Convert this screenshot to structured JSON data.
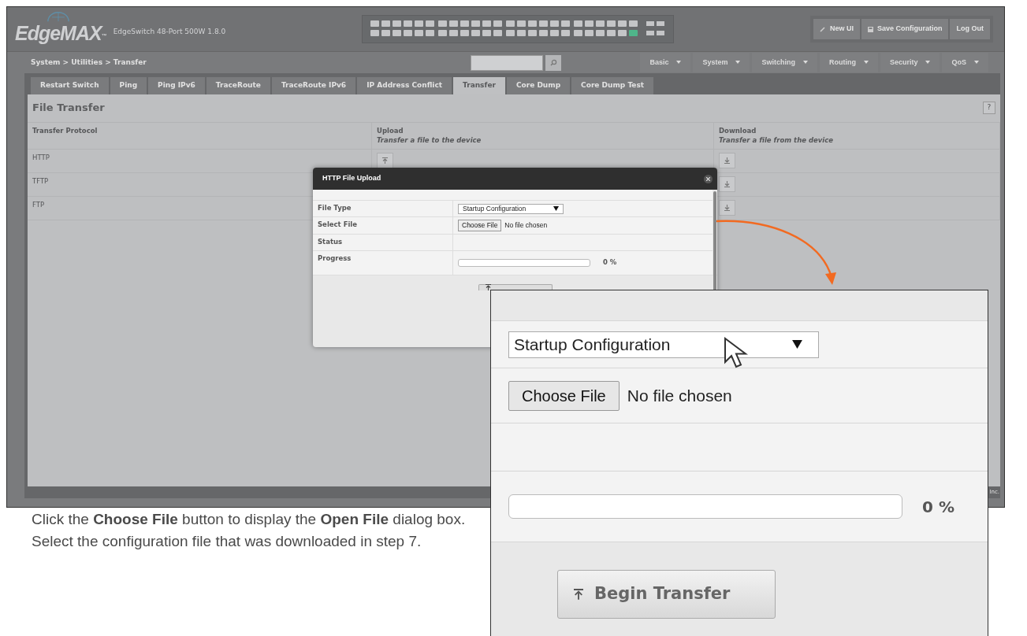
{
  "header": {
    "logo": "EdgeMAX",
    "logo_mark": "™",
    "device": "EdgeSwitch 48-Port 500W 1.8.0",
    "buttons": [
      {
        "kind": "link",
        "label": "New UI"
      },
      {
        "kind": "save",
        "label": "Save Configuration"
      },
      {
        "kind": "plain",
        "label": "Log Out"
      }
    ]
  },
  "breadcrumb": "System > Utilities > Transfer",
  "menus": [
    "Basic",
    "System",
    "Switching",
    "Routing",
    "Security",
    "QoS"
  ],
  "tabs": [
    {
      "label": "Restart Switch",
      "selected": false
    },
    {
      "label": "Ping",
      "selected": false
    },
    {
      "label": "Ping IPv6",
      "selected": false
    },
    {
      "label": "TraceRoute",
      "selected": false
    },
    {
      "label": "TraceRoute IPv6",
      "selected": false
    },
    {
      "label": "IP Address Conflict",
      "selected": false
    },
    {
      "label": "Transfer",
      "selected": true
    },
    {
      "label": "Core Dump",
      "selected": false
    },
    {
      "label": "Core Dump Test",
      "selected": false
    }
  ],
  "panel": {
    "title": "File Transfer",
    "help": "?",
    "columns": [
      {
        "title": "Transfer Protocol"
      },
      {
        "title": "Upload",
        "subtitle": "Transfer a file to the device"
      },
      {
        "title": "Download",
        "subtitle": "Transfer a file from the device"
      }
    ],
    "rows": [
      "HTTP",
      "TFTP",
      "FTP"
    ]
  },
  "footer": "Inc.",
  "dialog": {
    "title": "HTTP File Upload",
    "fields": [
      {
        "kind": "select",
        "label": "File Type",
        "value": "Startup Configuration"
      },
      {
        "kind": "file",
        "label": "Select File",
        "button": "Choose File",
        "value": "No file chosen"
      },
      {
        "kind": "empty",
        "label": "Status"
      },
      {
        "kind": "progress",
        "label": "Progress",
        "level": 0,
        "reading": "0 %"
      }
    ]
  },
  "callout": {
    "fields": [
      {
        "kind": "select",
        "value": "Startup Configuration"
      },
      {
        "kind": "file",
        "button": "Choose File",
        "value": "No file chosen"
      },
      {
        "kind": "empty"
      },
      {
        "kind": "progress",
        "level": 0,
        "reading": "0 %"
      }
    ],
    "button": "Begin Transfer"
  },
  "caption": "Click the **Choose File** button to display the **Open File** dialog box. Select the configuration file that was downloaded in step 7."
}
